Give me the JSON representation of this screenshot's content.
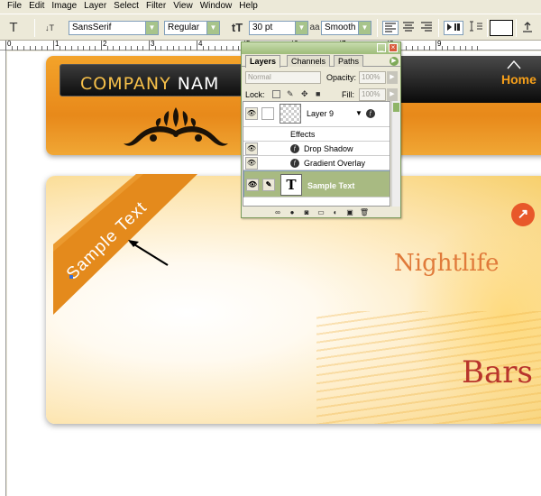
{
  "menu": [
    "File",
    "Edit",
    "Image",
    "Layer",
    "Select",
    "Filter",
    "View",
    "Window",
    "Help"
  ],
  "options_bar": {
    "tool_icon": "T",
    "orient_icon": "↓T",
    "font_family": "SansSerif",
    "font_style": "Regular",
    "size_icon": "tT",
    "font_size": "30 pt",
    "aa_icon": "aa",
    "antialias": "Smooth",
    "align_icons": [
      "align-left-icon",
      "align-center-icon",
      "align-right-icon"
    ],
    "warp_icon": "warp-text-icon",
    "palette_toggle_icon": "character-palette-icon"
  },
  "ruler": [
    "0",
    "1",
    "2",
    "3",
    "4",
    "5",
    "6",
    "7",
    "8",
    "9"
  ],
  "canvas": {
    "logo_word1": "COMPANY",
    "logo_word2": "NAM",
    "home": "Home",
    "headline": "Nightlife",
    "headline2": "Bars",
    "ribbon_text": "Sample Text"
  },
  "layers_palette": {
    "tabs": [
      "Layers",
      "Channels",
      "Paths"
    ],
    "blend_mode": "Normal",
    "opacity_label": "Opacity:",
    "opacity": "100%",
    "lock_label": "Lock:",
    "fill_label": "Fill:",
    "fill": "100%",
    "layers": [
      {
        "name": "Layer 9",
        "type": "shape"
      },
      {
        "name": "Effects",
        "type": "effects-header"
      },
      {
        "name": "Drop Shadow",
        "type": "effect"
      },
      {
        "name": "Gradient Overlay",
        "type": "effect"
      },
      {
        "name": "Sample Text",
        "type": "text",
        "selected": true
      }
    ],
    "thumb_text_glyph": "T",
    "fx_glyph": "ƒ"
  },
  "colors": {
    "orange": "#e8891a",
    "palette_green": "#9ebc7a",
    "selected_layer": "#a8ba82"
  }
}
